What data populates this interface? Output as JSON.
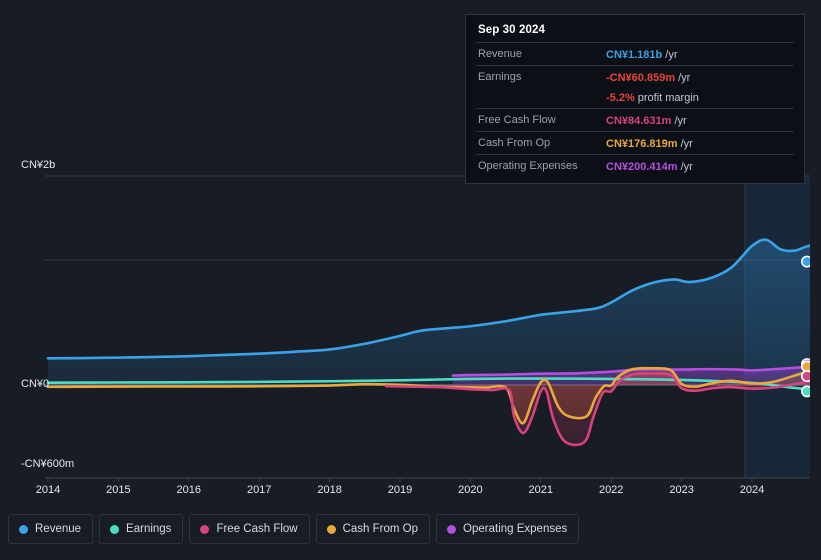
{
  "tooltip": {
    "date": "Sep 30 2024",
    "rows": [
      {
        "label": "Revenue",
        "value": "CN¥1.181b",
        "unit": "/yr",
        "color": "#3aa3e8"
      },
      {
        "label": "Earnings",
        "value": "-CN¥60.859m",
        "unit": "/yr",
        "color": "#e8453c"
      },
      {
        "label": "",
        "value": "-5.2%",
        "unit": "profit margin",
        "color": "#e8453c"
      },
      {
        "label": "Free Cash Flow",
        "value": "CN¥84.631m",
        "unit": "/yr",
        "color": "#d6437f"
      },
      {
        "label": "Cash From Op",
        "value": "CN¥176.819m",
        "unit": "/yr",
        "color": "#e8a83d"
      },
      {
        "label": "Operating Expenses",
        "value": "CN¥200.414m",
        "unit": "/yr",
        "color": "#b44fe0"
      }
    ]
  },
  "axis": {
    "y_top": "CN¥2b",
    "y_zero": "CN¥0",
    "y_bottom": "-CN¥600m",
    "x_ticks": [
      "2014",
      "2015",
      "2016",
      "2017",
      "2018",
      "2019",
      "2020",
      "2021",
      "2022",
      "2023",
      "2024"
    ]
  },
  "legend": {
    "items": [
      {
        "label": "Revenue",
        "color": "#3aa3e8"
      },
      {
        "label": "Earnings",
        "color": "#4fdcc4"
      },
      {
        "label": "Free Cash Flow",
        "color": "#d6437f"
      },
      {
        "label": "Cash From Op",
        "color": "#e8a83d"
      },
      {
        "label": "Operating Expenses",
        "color": "#b44fe0"
      }
    ]
  },
  "chart_data": {
    "type": "area",
    "title": "",
    "xlabel": "",
    "ylabel": "CN¥",
    "ylim": [
      -600000000,
      2000000000
    ],
    "y_ticks": [
      2000000000,
      0,
      -600000000
    ],
    "y_tick_labels": [
      "CN¥2b",
      "CN¥0",
      "-CN¥600m"
    ],
    "x": [
      "2014",
      "2015",
      "2016",
      "2017",
      "2018",
      "2019",
      "2020",
      "2021",
      "2022",
      "2023",
      "2024"
    ],
    "grid": true,
    "legend_position": "bottom",
    "forecast_start": "2023.9",
    "series": [
      {
        "name": "Revenue",
        "color": "#3aa3e8",
        "unit": "CN¥",
        "points": [
          {
            "t": 2014.0,
            "v": 255
          },
          {
            "t": 2014.5,
            "v": 258
          },
          {
            "t": 2015.0,
            "v": 262
          },
          {
            "t": 2015.5,
            "v": 268
          },
          {
            "t": 2016.0,
            "v": 276
          },
          {
            "t": 2016.5,
            "v": 288
          },
          {
            "t": 2017.0,
            "v": 300
          },
          {
            "t": 2017.5,
            "v": 318
          },
          {
            "t": 2018.0,
            "v": 340
          },
          {
            "t": 2018.5,
            "v": 395
          },
          {
            "t": 2019.0,
            "v": 470
          },
          {
            "t": 2019.3,
            "v": 520
          },
          {
            "t": 2019.7,
            "v": 545
          },
          {
            "t": 2020.0,
            "v": 562
          },
          {
            "t": 2020.5,
            "v": 610
          },
          {
            "t": 2021.0,
            "v": 672
          },
          {
            "t": 2021.4,
            "v": 700
          },
          {
            "t": 2021.8,
            "v": 735
          },
          {
            "t": 2022.0,
            "v": 790
          },
          {
            "t": 2022.3,
            "v": 905
          },
          {
            "t": 2022.6,
            "v": 980
          },
          {
            "t": 2022.9,
            "v": 1010
          },
          {
            "t": 2023.1,
            "v": 985
          },
          {
            "t": 2023.4,
            "v": 1020
          },
          {
            "t": 2023.7,
            "v": 1120
          },
          {
            "t": 2024.0,
            "v": 1330
          },
          {
            "t": 2024.2,
            "v": 1390
          },
          {
            "t": 2024.4,
            "v": 1300
          },
          {
            "t": 2024.6,
            "v": 1285
          },
          {
            "t": 2024.8,
            "v": 1330
          },
          {
            "t": 2025.0,
            "v": 1340
          },
          {
            "t": 2025.25,
            "v": 1181
          }
        ],
        "end_value": 1181
      },
      {
        "name": "Earnings",
        "color": "#4fdcc4",
        "unit": "CN¥",
        "points": [
          {
            "t": 2014.0,
            "v": 22
          },
          {
            "t": 2015.0,
            "v": 24
          },
          {
            "t": 2016.0,
            "v": 26
          },
          {
            "t": 2017.0,
            "v": 30
          },
          {
            "t": 2018.0,
            "v": 36
          },
          {
            "t": 2019.0,
            "v": 45
          },
          {
            "t": 2020.0,
            "v": 58
          },
          {
            "t": 2021.0,
            "v": 62
          },
          {
            "t": 2022.0,
            "v": 58
          },
          {
            "t": 2023.0,
            "v": 48
          },
          {
            "t": 2024.0,
            "v": 20
          },
          {
            "t": 2024.5,
            "v": -20
          },
          {
            "t": 2025.0,
            "v": -55
          },
          {
            "t": 2025.25,
            "v": -61
          }
        ],
        "end_value": -61
      },
      {
        "name": "Free Cash Flow",
        "color": "#d6437f",
        "unit": "CN¥",
        "points": [
          {
            "t": 2018.8,
            "v": -10
          },
          {
            "t": 2019.0,
            "v": -14
          },
          {
            "t": 2019.3,
            "v": -18
          },
          {
            "t": 2019.6,
            "v": -22
          },
          {
            "t": 2020.0,
            "v": -40
          },
          {
            "t": 2020.3,
            "v": -48
          },
          {
            "t": 2020.55,
            "v": -50
          },
          {
            "t": 2020.62,
            "v": -300
          },
          {
            "t": 2020.75,
            "v": -460
          },
          {
            "t": 2020.88,
            "v": -300
          },
          {
            "t": 2021.0,
            "v": -60
          },
          {
            "t": 2021.08,
            "v": -60
          },
          {
            "t": 2021.18,
            "v": -330
          },
          {
            "t": 2021.35,
            "v": -545
          },
          {
            "t": 2021.62,
            "v": -545
          },
          {
            "t": 2021.75,
            "v": -300
          },
          {
            "t": 2021.88,
            "v": -75
          },
          {
            "t": 2022.0,
            "v": -60
          },
          {
            "t": 2022.12,
            "v": 40
          },
          {
            "t": 2022.3,
            "v": 100
          },
          {
            "t": 2022.6,
            "v": 110
          },
          {
            "t": 2022.85,
            "v": 95
          },
          {
            "t": 2023.0,
            "v": -30
          },
          {
            "t": 2023.2,
            "v": -55
          },
          {
            "t": 2023.45,
            "v": -30
          },
          {
            "t": 2023.7,
            "v": -20
          },
          {
            "t": 2024.0,
            "v": -35
          },
          {
            "t": 2024.3,
            "v": -25
          },
          {
            "t": 2024.7,
            "v": 20
          },
          {
            "t": 2025.0,
            "v": 60
          },
          {
            "t": 2025.25,
            "v": 85
          }
        ],
        "end_value": 85
      },
      {
        "name": "Cash From Op",
        "color": "#e8a83d",
        "unit": "CN¥",
        "points": [
          {
            "t": 2014.0,
            "v": -18
          },
          {
            "t": 2015.0,
            "v": -15
          },
          {
            "t": 2016.0,
            "v": -14
          },
          {
            "t": 2017.0,
            "v": -12
          },
          {
            "t": 2018.0,
            "v": -5
          },
          {
            "t": 2018.5,
            "v": 8
          },
          {
            "t": 2019.0,
            "v": 2
          },
          {
            "t": 2019.4,
            "v": -12
          },
          {
            "t": 2019.8,
            "v": -20
          },
          {
            "t": 2020.2,
            "v": -25
          },
          {
            "t": 2020.5,
            "v": -25
          },
          {
            "t": 2020.62,
            "v": -230
          },
          {
            "t": 2020.75,
            "v": -365
          },
          {
            "t": 2020.88,
            "v": -150
          },
          {
            "t": 2021.0,
            "v": 25
          },
          {
            "t": 2021.1,
            "v": 25
          },
          {
            "t": 2021.25,
            "v": -210
          },
          {
            "t": 2021.4,
            "v": -300
          },
          {
            "t": 2021.65,
            "v": -300
          },
          {
            "t": 2021.78,
            "v": -120
          },
          {
            "t": 2021.9,
            "v": -10
          },
          {
            "t": 2022.0,
            "v": -5
          },
          {
            "t": 2022.1,
            "v": 80
          },
          {
            "t": 2022.3,
            "v": 150
          },
          {
            "t": 2022.6,
            "v": 160
          },
          {
            "t": 2022.85,
            "v": 140
          },
          {
            "t": 2023.0,
            "v": 10
          },
          {
            "t": 2023.2,
            "v": -15
          },
          {
            "t": 2023.45,
            "v": 20
          },
          {
            "t": 2023.7,
            "v": 40
          },
          {
            "t": 2024.0,
            "v": 15
          },
          {
            "t": 2024.3,
            "v": 30
          },
          {
            "t": 2024.7,
            "v": 110
          },
          {
            "t": 2025.0,
            "v": 160
          },
          {
            "t": 2025.25,
            "v": 177
          }
        ],
        "end_value": 177
      },
      {
        "name": "Operating Expenses",
        "color": "#b44fe0",
        "unit": "CN¥",
        "points": [
          {
            "t": 2019.75,
            "v": 90
          },
          {
            "t": 2020.0,
            "v": 95
          },
          {
            "t": 2020.5,
            "v": 100
          },
          {
            "t": 2021.0,
            "v": 108
          },
          {
            "t": 2021.5,
            "v": 112
          },
          {
            "t": 2022.0,
            "v": 128
          },
          {
            "t": 2022.3,
            "v": 145
          },
          {
            "t": 2022.6,
            "v": 150
          },
          {
            "t": 2023.0,
            "v": 148
          },
          {
            "t": 2023.4,
            "v": 152
          },
          {
            "t": 2023.8,
            "v": 148
          },
          {
            "t": 2024.0,
            "v": 140
          },
          {
            "t": 2024.4,
            "v": 155
          },
          {
            "t": 2024.8,
            "v": 175
          },
          {
            "t": 2025.0,
            "v": 190
          },
          {
            "t": 2025.25,
            "v": 200
          }
        ],
        "end_value": 200
      }
    ]
  }
}
